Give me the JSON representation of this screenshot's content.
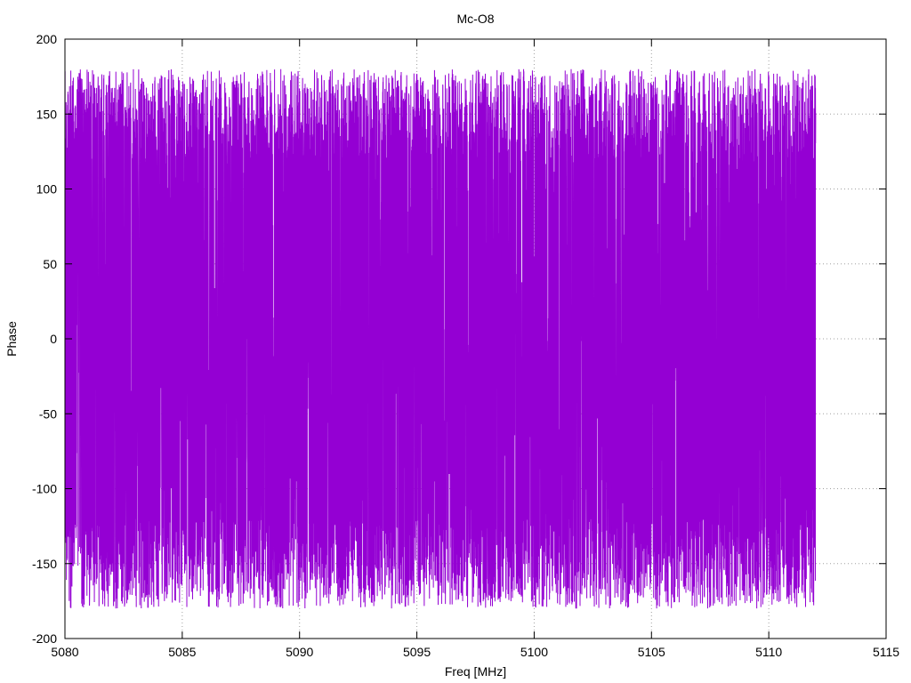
{
  "chart_data": {
    "type": "line",
    "title": "Mc-O8",
    "xlabel": "Freq [MHz]",
    "ylabel": "Phase",
    "xlim": [
      5080,
      5115
    ],
    "ylim": [
      -200,
      200
    ],
    "xticks": [
      5080,
      5085,
      5090,
      5095,
      5100,
      5105,
      5110,
      5115
    ],
    "yticks": [
      -200,
      -150,
      -100,
      -50,
      0,
      50,
      100,
      150,
      200
    ],
    "grid": true,
    "series": [
      {
        "color": "#9400d3",
        "x_range": [
          5080,
          5112
        ],
        "value_range": [
          -180,
          180
        ],
        "description": "dense oscillating phase trace spanning -180 to 180 degrees"
      }
    ]
  }
}
